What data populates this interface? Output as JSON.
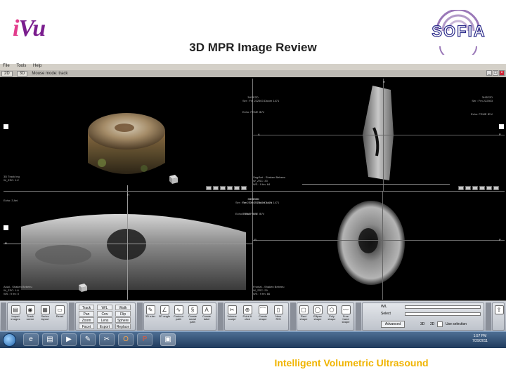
{
  "header": {
    "logo_i": "i",
    "logo_vu": "Vu",
    "slide_title": "3D MPR Image Review",
    "logo_right": "SOFIA"
  },
  "menubar": [
    "File",
    "Tools",
    "Help"
  ],
  "topbar": {
    "btn_2d": "2D",
    "btn_3d": "3D",
    "mouse_mode": "Mouse mode: track"
  },
  "quads": {
    "tl": {
      "tl_text": "",
      "bl_text": [
        "3D Track Ing",
        "W_ZSC: 1:2"
      ]
    },
    "tr": {
      "header": [
        "3HSE2D",
        "Ser : Fm 222503 Dicom 1471"
      ],
      "mid_l": "Echo: FEME IE/V",
      "right_col": [
        "3HSE2D",
        "Ser : Fm 222503",
        "Echo: FEME IE/V"
      ],
      "bl_text": [
        "Sag/Ant - Shaken Bebeeu",
        "W_ZSC: 33",
        "WS : 9 fm: 64"
      ],
      "marker_a": "A",
      "marker_h": "H",
      "marker_p": "P"
    },
    "bl": {
      "header": [
        "3HSE2D",
        "Ser : Fm 222503 Dicom 1471"
      ],
      "mid_l": "Echo: FEME IE/V",
      "bl_text": [
        "Axial - Shaken Bebeeu",
        "W_ZSC: 1:0",
        "WS : 9 fm: 0"
      ],
      "marker_r": "R",
      "marker_h": "H",
      "left_label": "Echo: 3 Ani"
    },
    "br": {
      "header": [
        "3HSE2D",
        "Ser : Fm 222503 Dicom 1471"
      ],
      "mid_l": "Echo: FEME IE/V",
      "bl_text": [
        "Frontal - Shaken Bebeeu",
        "W_ZSC: 29",
        "WS : 9 fm: 66"
      ],
      "marker_r": "R",
      "marker_p": "P"
    }
  },
  "toolbar": {
    "group1_tab": "Layout",
    "group1": [
      "Import images",
      "Track scene",
      "Series layout",
      "Reset"
    ],
    "group2_tab": "Browse",
    "group2_grid": [
      "Track",
      "W/L",
      "Walk",
      "Pan",
      "Crw",
      "Flip",
      "Zoom",
      "Lens",
      "Sphere",
      "Facet",
      "Export",
      "Replace"
    ],
    "group3_tab": "Measure",
    "group3": [
      "3D ruler",
      "3D angle",
      "Contour path",
      "Create smart path",
      "Create label"
    ],
    "group4_tab": "Sculpt",
    "group4": [
      "Volume sculpt",
      "Point & click",
      "Create shape",
      "New ROI"
    ],
    "group5_tab": "Shapes",
    "group5": [
      "Rect shape",
      "Ellipse shape",
      "Poly shape",
      "Free hand shape"
    ],
    "group6_tab": "WL",
    "wl_label": "W/L",
    "select_label": "Select",
    "advanced": "Advanced",
    "btn_3d": "3D",
    "btn_2d": "2D",
    "use_selection": "Use selection",
    "group7_tab": "Export"
  },
  "taskbar": {
    "clock_time": "1:57 PM",
    "clock_date": "7/29/2011"
  },
  "tagline": "Intelligent Volumetric Ultrasound"
}
